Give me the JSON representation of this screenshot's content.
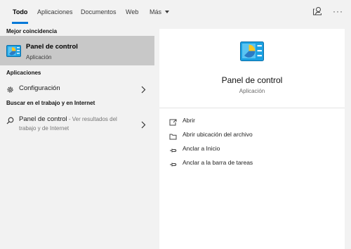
{
  "tabs": {
    "todo": "Todo",
    "apps": "Aplicaciones",
    "docs": "Documentos",
    "web": "Web",
    "more": "Más"
  },
  "sections": {
    "best_match": "Mejor coincidencia",
    "apps": "Aplicaciones",
    "work_web": "Buscar en el trabajo y en Internet"
  },
  "best_match": {
    "title": "Panel de control",
    "subtitle": "Aplicación",
    "icon": "control-panel-icon"
  },
  "apps_results": [
    {
      "label": "Configuración",
      "icon": "gear-icon"
    }
  ],
  "web_result": {
    "title": "Panel de control",
    "desc_line1": " - Ver resultados del",
    "desc_line2": "trabajo y de Internet",
    "icon": "search-icon"
  },
  "preview": {
    "title": "Panel de control",
    "subtitle": "Aplicación",
    "actions": [
      {
        "label": "Abrir",
        "icon": "open-icon"
      },
      {
        "label": "Abrir ubicación del archivo",
        "icon": "folder-location-icon"
      },
      {
        "label": "Anclar a Inicio",
        "icon": "pin-icon"
      },
      {
        "label": "Anclar a la barra de tareas",
        "icon": "pin-icon"
      }
    ]
  },
  "colors": {
    "accent": "#0078d7",
    "selected_bg": "#c8c8c8",
    "pane_bg": "#f2f2f2",
    "preview_bg": "#ffffff"
  }
}
